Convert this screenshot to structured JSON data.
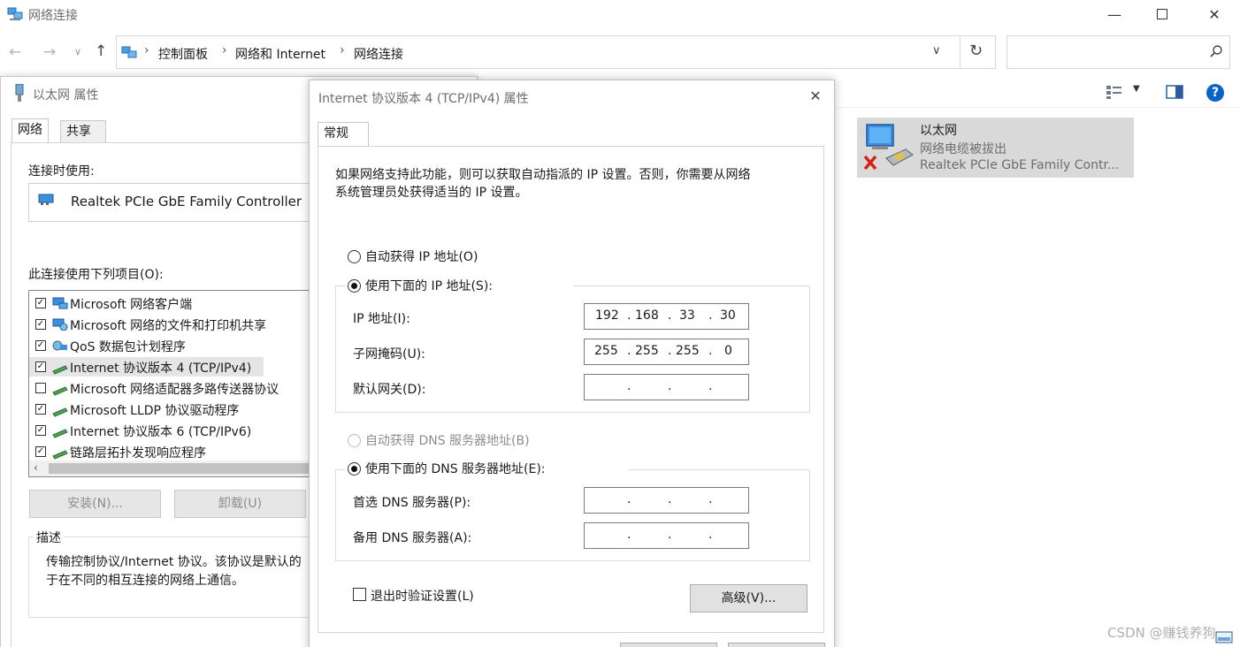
{
  "window": {
    "title": "网络连接"
  },
  "address": {
    "crumbs": [
      "控制面板",
      "网络和 Internet",
      "网络连接"
    ],
    "search_placeholder": ""
  },
  "network_item": {
    "name": "以太网",
    "status": "网络电缆被拔出",
    "adapter": "Realtek PCIe GbE Family Contr..."
  },
  "props": {
    "title": "以太网 属性",
    "tabs": [
      "网络",
      "共享"
    ],
    "connect_using_label": "连接时使用:",
    "adapter": "Realtek PCIe GbE Family Controller",
    "items_label": "此连接使用下列项目(O):",
    "items": [
      {
        "label": "Microsoft 网络客户端",
        "checked": true,
        "icon": "client-icon"
      },
      {
        "label": "Microsoft 网络的文件和打印机共享",
        "checked": true,
        "icon": "share-icon"
      },
      {
        "label": "QoS 数据包计划程序",
        "checked": true,
        "icon": "qos-icon"
      },
      {
        "label": "Internet 协议版本 4 (TCP/IPv4)",
        "checked": true,
        "icon": "protocol-icon"
      },
      {
        "label": "Microsoft 网络适配器多路传送器协议",
        "checked": false,
        "icon": "protocol-icon"
      },
      {
        "label": "Microsoft LLDP 协议驱动程序",
        "checked": true,
        "icon": "protocol-icon"
      },
      {
        "label": "Internet 协议版本 6 (TCP/IPv6)",
        "checked": true,
        "icon": "protocol-icon"
      },
      {
        "label": "链路层拓扑发现响应程序",
        "checked": true,
        "icon": "protocol-icon"
      }
    ],
    "install_label": "安装(N)...",
    "uninstall_label": "卸载(U)",
    "desc_label": "描述",
    "desc_line1": "传输控制协议/Internet 协议。该协议是默认的",
    "desc_line2": "于在不同的相互连接的网络上通信。"
  },
  "ipv4": {
    "title": "Internet 协议版本 4 (TCP/IPv4) 属性",
    "tab": "常规",
    "intro_line1": "如果网络支持此功能，则可以获取自动指派的 IP 设置。否则，你需要从网络",
    "intro_line2": "系统管理员处获得适当的 IP 设置。",
    "auto_ip": "自动获得 IP 地址(O)",
    "manual_ip": "使用下面的 IP 地址(S):",
    "ip_label": "IP 地址(I):",
    "ip": [
      "192",
      "168",
      "33",
      "30"
    ],
    "mask_label": "子网掩码(U):",
    "mask": [
      "255",
      "255",
      "255",
      "0"
    ],
    "gateway_label": "默认网关(D):",
    "auto_dns": "自动获得 DNS 服务器地址(B)",
    "manual_dns": "使用下面的 DNS 服务器地址(E):",
    "dns1_label": "首选 DNS 服务器(P):",
    "dns2_label": "备用 DNS 服务器(A):",
    "validate_label": "退出时验证设置(L)",
    "advanced_label": "高级(V)..."
  },
  "watermark": "CSDN @赚钱养狗",
  "colors": {
    "accent": "#0067c0",
    "help": "#0a64c8",
    "selected_item": "#e5e5e5",
    "disabled_text": "#8d8d8d"
  }
}
